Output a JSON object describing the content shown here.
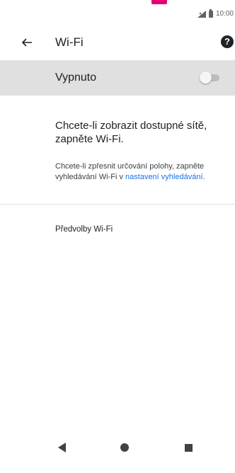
{
  "status_bar": {
    "time": "10:00",
    "icons": [
      "signal-icon",
      "battery-icon"
    ]
  },
  "app_bar": {
    "back_icon": "arrow-back-icon",
    "title": "Wi-Fi",
    "help_icon": "help-icon",
    "help_glyph": "?"
  },
  "wifi_switch": {
    "label": "Vypnuto",
    "enabled": false
  },
  "info": {
    "main_text": "Chcete-li zobrazit dostupné sítě, zapněte Wi-Fi.",
    "sub_text_before": "Chcete-li zpřesnit určování polohy, zapněte vyhledávání Wi-Fi v ",
    "sub_link": "nastavení vyhledávání",
    "sub_text_after": "."
  },
  "preferences": {
    "label": "Předvolby Wi-Fi"
  },
  "nav_bar": {
    "items": [
      "back-triangle-icon",
      "home-circle-icon",
      "recents-square-icon"
    ]
  },
  "colors": {
    "brand": "#e20074",
    "link": "#1a73e8",
    "switch_bar": "#e0e0e0"
  }
}
